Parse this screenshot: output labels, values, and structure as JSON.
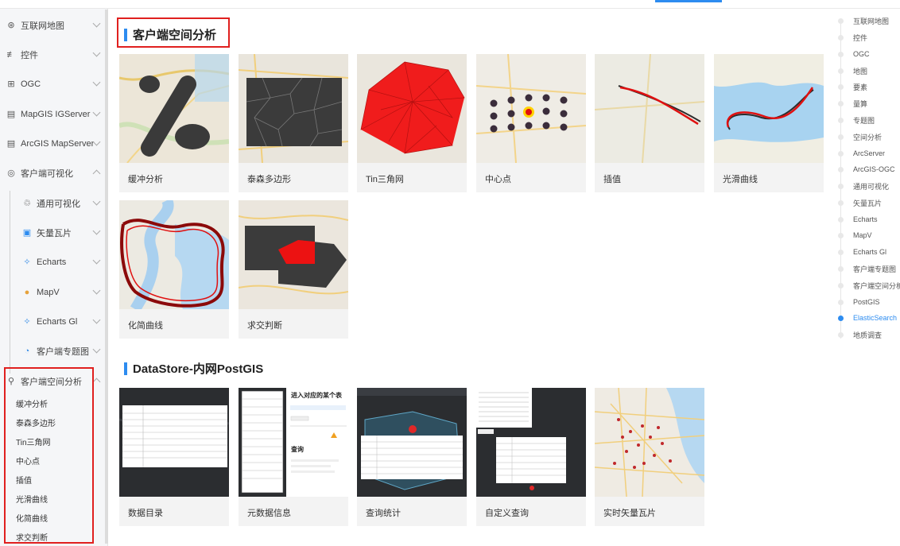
{
  "sidebar": {
    "items": [
      {
        "label": "互联网地图",
        "icon": "globe-icon"
      },
      {
        "label": "控件",
        "icon": "sliders-icon"
      },
      {
        "label": "OGC",
        "icon": "grid-icon"
      },
      {
        "label": "MapGIS IGServer",
        "icon": "server-icon"
      },
      {
        "label": "ArcGIS MapServer",
        "icon": "server-icon"
      },
      {
        "label": "客户端可视化",
        "icon": "eye-icon"
      }
    ],
    "visual_children": [
      {
        "label": "通用可视化",
        "icon": "cluster-icon"
      },
      {
        "label": "矢量瓦片",
        "icon": "tile-icon"
      },
      {
        "label": "Echarts",
        "icon": "echarts-icon"
      },
      {
        "label": "MapV",
        "icon": "user-icon"
      },
      {
        "label": "Echarts Gl",
        "icon": "echarts-icon"
      },
      {
        "label": "客户端专题图",
        "icon": "theme-icon"
      }
    ],
    "spatial_group": {
      "label": "客户端空间分析",
      "icon": "analysis-icon"
    },
    "spatial_children": [
      "缓冲分析",
      "泰森多边形",
      "Tin三角网",
      "中心点",
      "插值",
      "光滑曲线",
      "化简曲线",
      "求交判断"
    ]
  },
  "section1": {
    "title": "客户端空间分析",
    "cards": [
      "缓冲分析",
      "泰森多边形",
      "Tin三角网",
      "中心点",
      "插值",
      "光滑曲线",
      "化简曲线",
      "求交判断"
    ]
  },
  "section2": {
    "title": "DataStore-内网PostGIS",
    "cards": [
      "数据目录",
      "元数据信息",
      "查询统计",
      "自定义查询",
      "实时矢量瓦片"
    ]
  },
  "toc": {
    "items": [
      "互联网地图",
      "控件",
      "OGC",
      "地图",
      "要素",
      "量算",
      "专题图",
      "空间分析",
      "ArcServer",
      "ArcGIS-OGC",
      "通用可视化",
      "矢量瓦片",
      "Echarts",
      "MapV",
      "Echarts Gl",
      "客户端专题图",
      "客户端空间分析",
      "PostGIS",
      "ElasticSearch",
      "地质调查"
    ],
    "active": "ElasticSearch"
  },
  "thumb_text": {
    "metadata_heading": "进入对应的某个表",
    "query_label": "查询"
  },
  "colors": {
    "accent": "#2d8cf0",
    "highlight_box": "#e0201f",
    "sidebar_bg": "#f5f6f8"
  }
}
